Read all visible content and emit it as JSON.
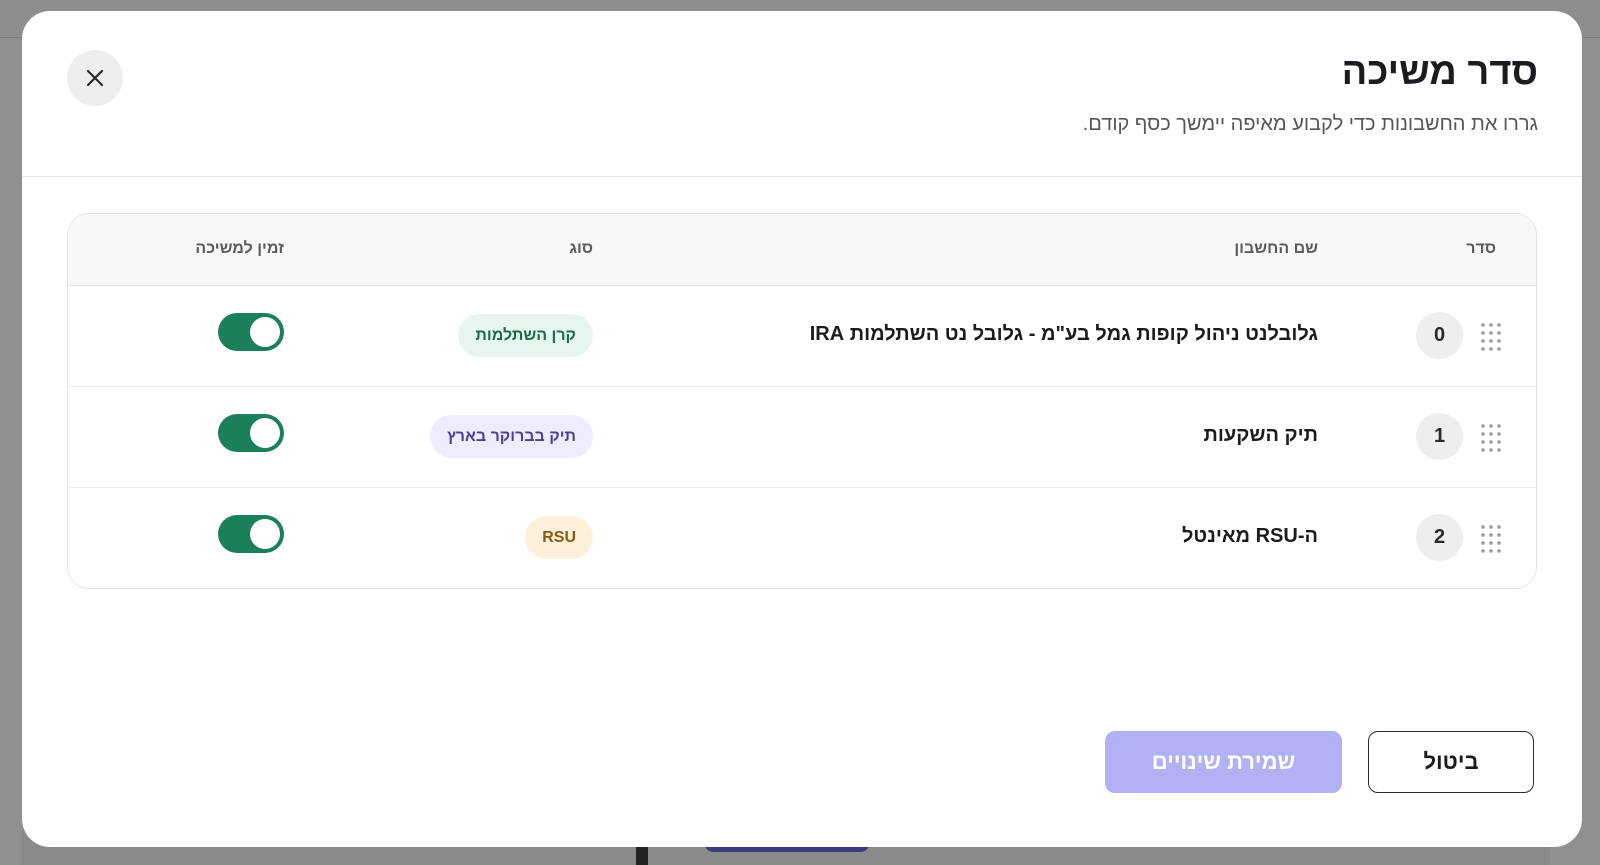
{
  "modal": {
    "title": "סדר משיכה",
    "subtitle": "גררו את החשבונות כדי לקבוע מאיפה יימשך כסף קודם."
  },
  "table": {
    "headers": {
      "order": "סדר",
      "name": "שם החשבון",
      "type": "סוג",
      "withdrawable": "זמין למשיכה"
    },
    "rows": [
      {
        "order": "0",
        "name": "גלובלנט ניהול קופות גמל בע\"מ - גלובל נט השתלמות IRA",
        "type": "קרן השתלמות",
        "type_bg": "#e6f5ee",
        "type_color": "#1b6b47",
        "withdrawable": true
      },
      {
        "order": "1",
        "name": "תיק השקעות",
        "type": "תיק בברוקר בארץ",
        "type_bg": "#efedfd",
        "type_color": "#4a3f9c",
        "withdrawable": true
      },
      {
        "order": "2",
        "name": "ה-RSU מאינטל",
        "type": "RSU",
        "type_bg": "#fdf1dc",
        "type_color": "#8a5a0c",
        "withdrawable": true
      }
    ]
  },
  "footer": {
    "save_label": "שמירת שינויים",
    "cancel_label": "ביטול"
  },
  "colors": {
    "toggle_on": "#1b7f5a",
    "save_disabled": "#b3b1f5"
  },
  "icons": {
    "close": "close-icon",
    "drag": "drag-handle-icon"
  }
}
